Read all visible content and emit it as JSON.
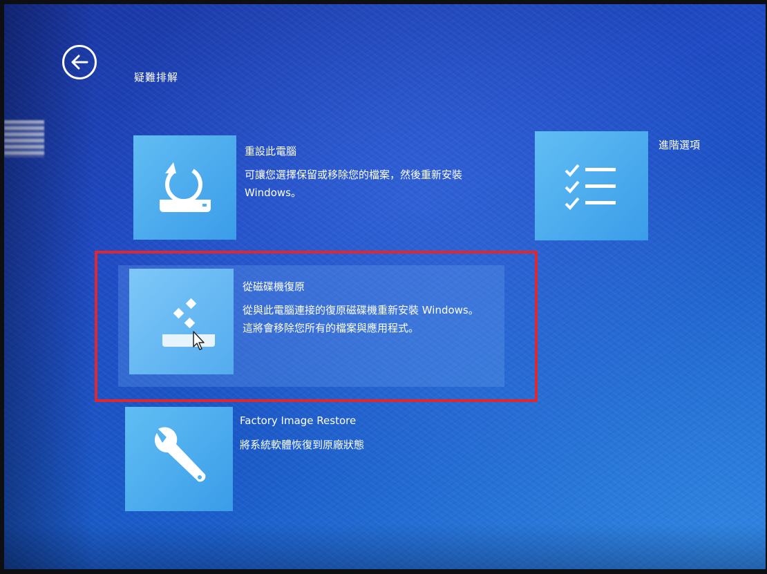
{
  "header": {
    "back_icon": "arrow-left-icon",
    "title": "疑難排解"
  },
  "options": [
    {
      "id": "reset-pc",
      "title": "重設此電腦",
      "description": "可讓您選擇保留或移除您的檔案，然後重新安裝 Windows。",
      "icon": "reset-refresh-icon"
    },
    {
      "id": "advanced-options",
      "title": "進階選項",
      "icon": "checklist-icon"
    },
    {
      "id": "recover-from-drive",
      "title": "從磁碟機復原",
      "description": "從與此電腦連接的復原磁碟機重新安裝 Windows。這將會移除您所有的檔案與應用程式。",
      "icon": "drive-recovery-icon",
      "highlighted": true
    },
    {
      "id": "factory-image-restore",
      "title": "Factory Image Restore",
      "description": "將系統軟體恢復到原廠狀態",
      "icon": "wrench-icon"
    }
  ],
  "colors": {
    "background": "#1f4bc4",
    "tile": "#4fb3ef",
    "highlight_box": "#e0262e",
    "text": "#ffffff"
  }
}
